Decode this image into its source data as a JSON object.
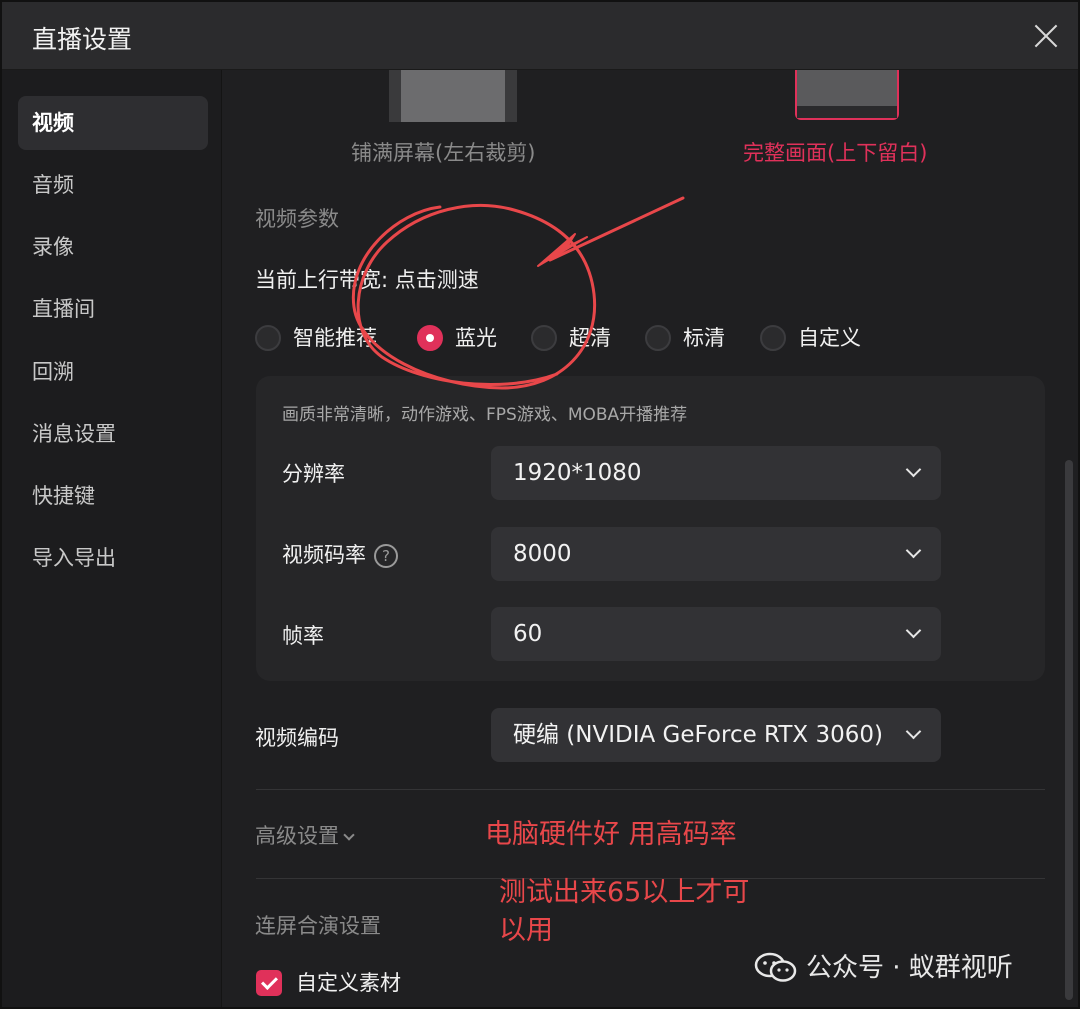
{
  "window": {
    "title": "直播设置"
  },
  "sidebar": {
    "items": [
      {
        "label": "视频",
        "active": true
      },
      {
        "label": "音频"
      },
      {
        "label": "录像"
      },
      {
        "label": "直播间"
      },
      {
        "label": "回溯"
      },
      {
        "label": "消息设置"
      },
      {
        "label": "快捷键"
      },
      {
        "label": "导入导出"
      }
    ]
  },
  "layout_options": {
    "fill_label": "铺满屏幕(左右裁剪)",
    "full_label": "完整画面(上下留白)"
  },
  "video_params": {
    "section_label": "视频参数",
    "bandwidth_label": "当前上行带宽:",
    "bandwidth_link": "点击测速",
    "quality_options": [
      "智能推荐",
      "蓝光",
      "超清",
      "标清",
      "自定义"
    ],
    "selected_quality": "蓝光",
    "quality_description": "画质非常清晰，动作游戏、FPS游戏、MOBA开播推荐",
    "resolution": {
      "label": "分辨率",
      "value": "1920*1080"
    },
    "bitrate": {
      "label": "视频码率",
      "help": "?",
      "value": "8000"
    },
    "framerate": {
      "label": "帧率",
      "value": "60"
    },
    "encoder": {
      "label": "视频编码",
      "value": "硬编 (NVIDIA GeForce RTX 3060)"
    }
  },
  "advanced": {
    "label": "高级设置"
  },
  "co_stream": {
    "label": "连屏合演设置",
    "custom_material": "自定义素材",
    "custom_material_checked": true
  },
  "annotations": {
    "note1": "电脑硬件好 用高码率",
    "note2_line1": "测试出来65以上才可",
    "note2_line2": "以用"
  },
  "watermark": {
    "text": "公众号 · 蚁群视听"
  },
  "colors": {
    "accent": "#e0315a",
    "annotation": "#e8474a",
    "background": "#1f1f21"
  }
}
